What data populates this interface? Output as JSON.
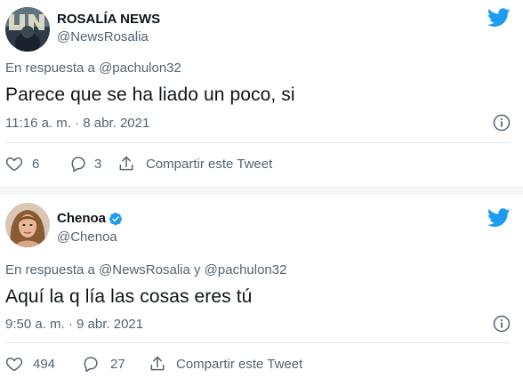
{
  "colors": {
    "twitter_blue": "#1d9bf0",
    "text_primary": "#0f1419",
    "text_secondary": "#536471"
  },
  "tweets": [
    {
      "author_name": "ROSALÍA NEWS",
      "author_handle": "@NewsRosalia",
      "verified": false,
      "reply_to": "En respuesta a @pachulon32",
      "text": "Parece que se ha liado un poco, si",
      "timestamp": "11:16 a. m. · 8 abr. 2021",
      "likes": "6",
      "replies": "3",
      "share_label": "Compartir este Tweet",
      "icons": [
        "twitter-bird-icon",
        "info-icon",
        "heart-icon",
        "reply-bubble-icon",
        "share-icon"
      ]
    },
    {
      "author_name": "Chenoa",
      "author_handle": "@Chenoa",
      "verified": true,
      "reply_to": "En respuesta a @NewsRosalia y @pachulon32",
      "text": "Aquí la q lía las cosas eres tú",
      "timestamp": "9:50 a. m. · 9 abr. 2021",
      "likes": "494",
      "replies": "27",
      "share_label": "Compartir este Tweet",
      "icons": [
        "twitter-bird-icon",
        "verified-badge-icon",
        "info-icon",
        "heart-icon",
        "reply-bubble-icon",
        "share-icon"
      ]
    }
  ]
}
